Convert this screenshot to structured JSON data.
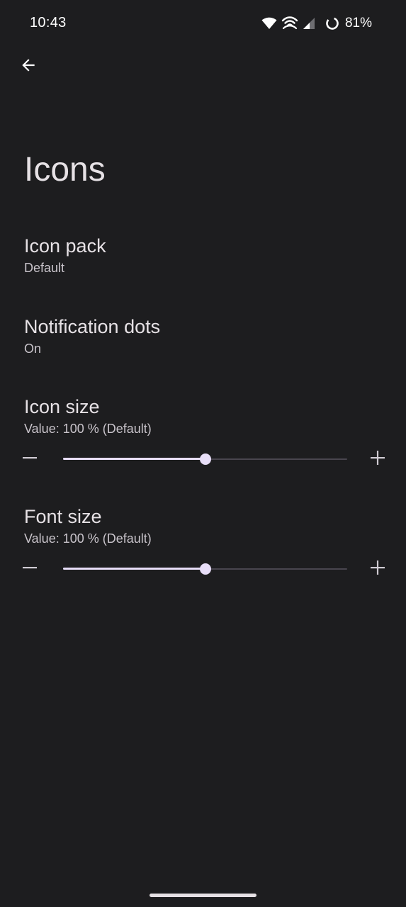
{
  "status_bar": {
    "time": "10:43",
    "battery": "81%",
    "icons": [
      "wifi-icon",
      "hotspot-icon",
      "cell-signal-icon",
      "battery-saver-ring-icon"
    ]
  },
  "header": {
    "back_icon": "arrow-back-icon",
    "title": "Icons"
  },
  "prefs": {
    "icon_pack": {
      "title": "Icon pack",
      "summary": "Default"
    },
    "notification_dots": {
      "title": "Notification dots",
      "summary": "On"
    },
    "icon_size": {
      "title": "Icon size",
      "summary": "Value: 100 % (Default)",
      "level": 0.5
    },
    "font_size": {
      "title": "Font size",
      "summary": "Value: 100 % (Default)",
      "level": 0.5
    }
  },
  "colors": {
    "background": "#1d1d1f",
    "text_primary": "#e6e1e5",
    "slider_active": "#e8def8",
    "slider_inactive": "#49454e"
  }
}
